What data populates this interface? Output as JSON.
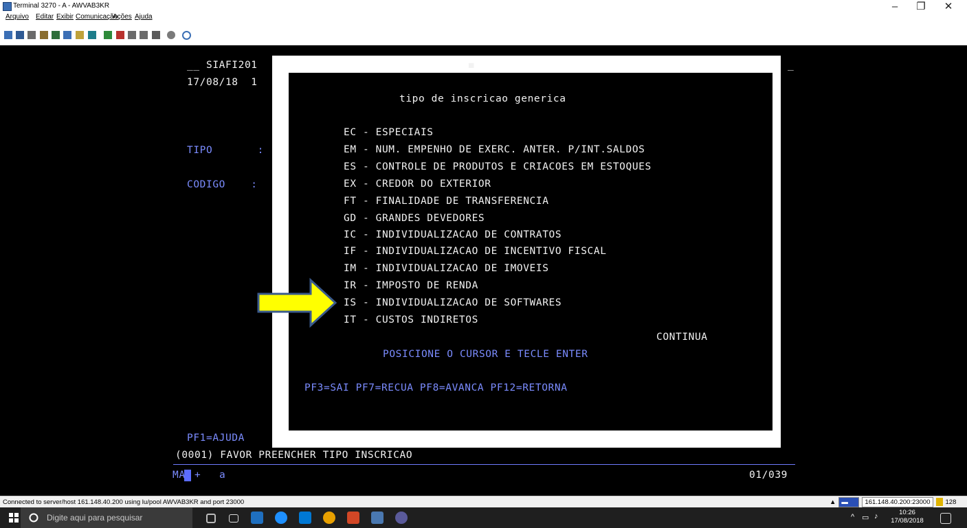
{
  "window": {
    "title": "Terminal 3270 - A - AWVAB3KR",
    "controls": [
      "–",
      "❐",
      "✕"
    ]
  },
  "menu": [
    "Arquivo",
    "Editar",
    "Exibir",
    "Comunicação",
    "Ações",
    "Ajuda"
  ],
  "toolbar_icons": [
    "copy-icon",
    "paste-icon",
    "cut-icon",
    "print-icon",
    "print-screen-icon",
    "session-icon",
    "macro-icon",
    "keyboard-icon",
    "send-icon",
    "receive-icon",
    "transfer-icon",
    "transfer2-icon",
    "disconnect-icon",
    "settings-icon",
    "help-icon"
  ],
  "screen": {
    "left_header": "__ SIAFI201",
    "date": "17/08/18  1",
    "tipo_label": "TIPO       :",
    "codigo_label": "CODIGO    :",
    "right_underscore": "_",
    "pf1": "PF1=AJUDA",
    "message": "(0001) FAVOR PREENCHER TIPO INSCRICAO",
    "oia_left": "MA",
    "oia_plus": "+",
    "oia_a": "a",
    "cursor_pos": "01/039"
  },
  "dialog": {
    "title": "tipo de inscricao generica",
    "items": [
      "EC - ESPECIAIS",
      "EM - NUM. EMPENHO DE EXERC. ANTER. P/INT.SALDOS",
      "ES - CONTROLE DE PRODUTOS E CRIACOES EM ESTOQUES",
      "EX - CREDOR DO EXTERIOR",
      "FT - FINALIDADE DE TRANSFERENCIA",
      "GD - GRANDES DEVEDORES",
      "IC - INDIVIDUALIZACAO DE CONTRATOS",
      "IF - INDIVIDUALIZACAO DE INCENTIVO FISCAL",
      "IM - INDIVIDUALIZACAO DE IMOVEIS",
      "IR - IMPOSTO DE RENDA",
      "IS - INDIVIDUALIZACAO DE SOFTWARES",
      "IT - CUSTOS INDIRETOS"
    ],
    "continua": "CONTINUA",
    "instruction": "POSICIONE O CURSOR E TECLE ENTER",
    "pf_keys": "PF3=SAI PF7=RECUA PF8=AVANCA PF12=RETORNA"
  },
  "statusbar": {
    "message": "Connected to server/host 161.148.40.200 using lu/pool AWVAB3KR and port 23000",
    "host": "161.148.40.200:23000",
    "count": "128"
  },
  "taskbar": {
    "search_placeholder": "Digite aqui para pesquisar",
    "time": "10:26",
    "date": "17/08/2018"
  },
  "colors": {
    "terminal_bg": "#000000",
    "terminal_blue": "#7b8cff",
    "terminal_white": "#f2f2f2",
    "arrow_fill": "#ffff00",
    "arrow_stroke": "#3a5a8c"
  }
}
